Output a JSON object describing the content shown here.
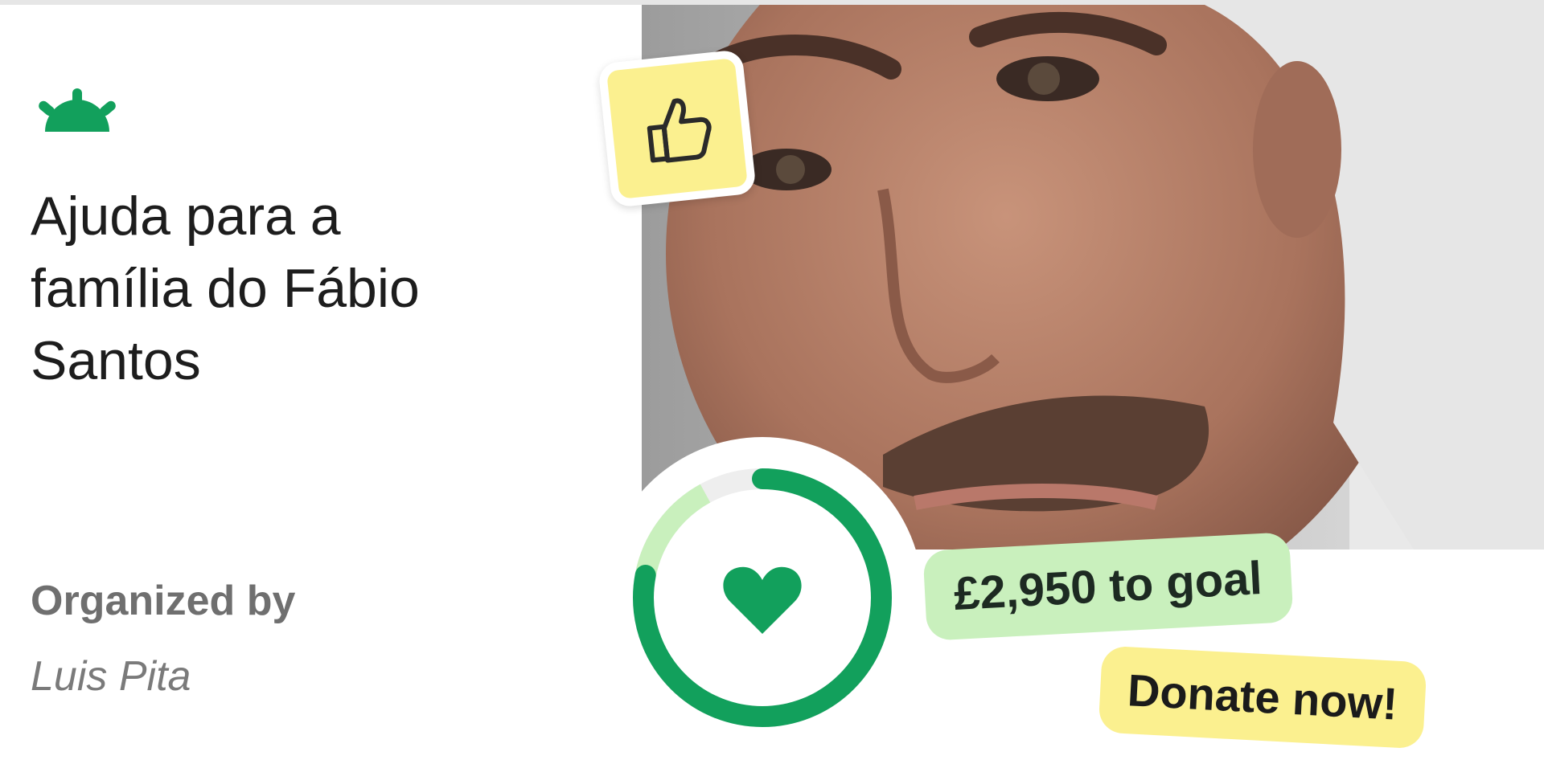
{
  "campaign": {
    "title_line1": "Ajuda para a",
    "title_line2": "família do Fábio",
    "title_line3": "Santos",
    "organized_label": "Organized by",
    "organizer_name": "Luis Pita"
  },
  "progress": {
    "goal_text": "£2,950 to goal",
    "fraction_raised": 0.78
  },
  "cta": {
    "donate_label": "Donate now!"
  },
  "icons": {
    "logo": "gofundme-sunrise-icon",
    "thumbs": "thumbs-up-icon",
    "heart": "heart-icon"
  },
  "colors": {
    "brand_green": "#12a05c",
    "light_green": "#c9f0bd",
    "ring_track": "#eeeeee",
    "yellow": "#fbf08f"
  }
}
